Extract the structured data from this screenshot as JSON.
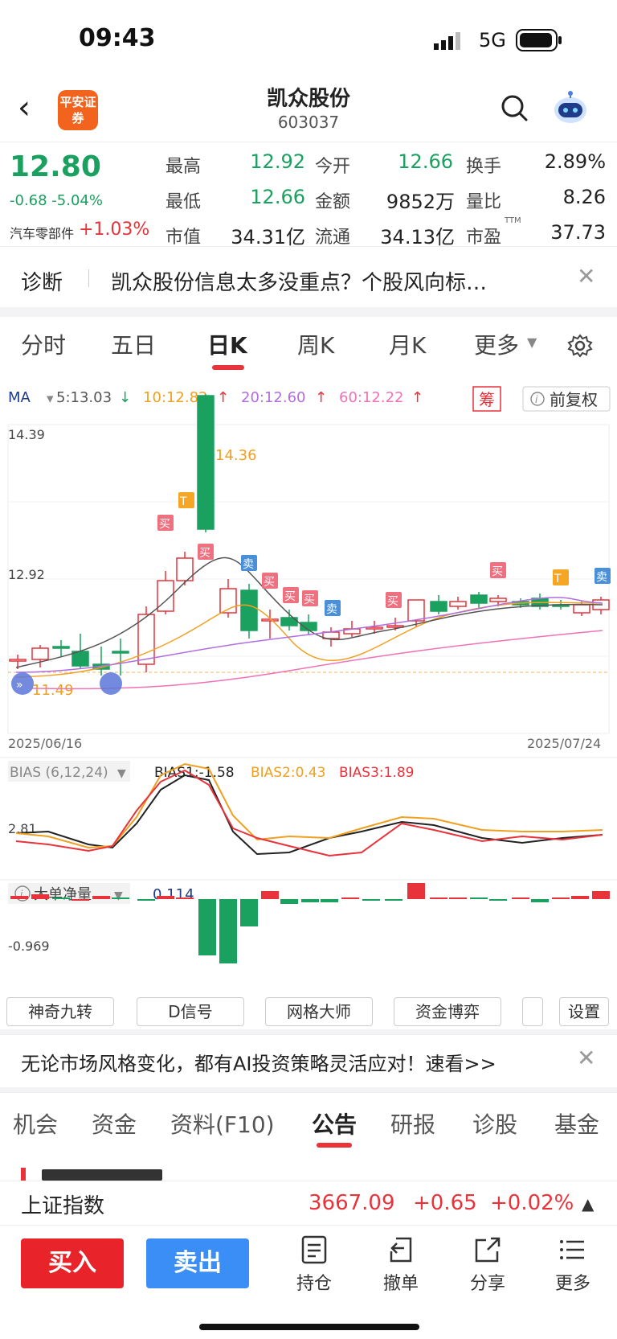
{
  "status_bar": {
    "time": "09:43",
    "network": "5G"
  },
  "header": {
    "logo_text": "平安证券",
    "stock_name": "凯众股份",
    "stock_code": "603037"
  },
  "quote": {
    "price": "12.80",
    "change": "-0.68 -5.04%",
    "sector": "汽车零部件",
    "sector_change": "+1.03%",
    "rows": [
      [
        {
          "label": "最高",
          "value": "12.92",
          "color": "#1aa15f"
        },
        {
          "label": "今开",
          "value": "12.66",
          "color": "#1aa15f"
        },
        {
          "label": "换手",
          "value": "2.89%",
          "color": "#222222"
        }
      ],
      [
        {
          "label": "最低",
          "value": "12.66",
          "color": "#1aa15f"
        },
        {
          "label": "金额",
          "value": "9852万",
          "color": "#222222"
        },
        {
          "label": "量比",
          "value": "8.26",
          "color": "#222222"
        }
      ],
      [
        {
          "label": "市值",
          "value": "34.31亿",
          "color": "#222222"
        },
        {
          "label": "流通",
          "value": "34.13亿",
          "color": "#222222"
        },
        {
          "label": "市盈",
          "value": "37.73",
          "color": "#222222"
        }
      ]
    ],
    "pe_suffix": "TTM"
  },
  "diagnosis": {
    "label": "诊断",
    "text": "凯众股份信息太多没重点？个股风向标…"
  },
  "period_tabs": [
    "分时",
    "五日",
    "日K",
    "周K",
    "月K",
    "更多"
  ],
  "ma_legend": {
    "label": "MA",
    "items": [
      {
        "text": "5:13.03",
        "arrow": "↓",
        "color": "#555555",
        "arrow_color": "#1aa15f"
      },
      {
        "text": "10:12.82",
        "arrow": "↑",
        "color": "#f0a020",
        "arrow_color": "#e8333a"
      },
      {
        "text": "20:12.60",
        "arrow": "↑",
        "color": "#b06ee0",
        "arrow_color": "#e8333a"
      },
      {
        "text": "60:12.22",
        "arrow": "↑",
        "color": "#f072b6",
        "arrow_color": "#e8333a"
      }
    ],
    "chip_label": "筹",
    "adjust_label": "前复权"
  },
  "kline": {
    "y_top_label": "14.39",
    "y_mid_label": "12.92",
    "y_low_label": "11.49",
    "high_label": "14.36",
    "date_start": "2025/06/16",
    "date_end": "2025/07/24",
    "signals": {
      "buy": "买",
      "sell": "卖",
      "t": "T"
    }
  },
  "bias": {
    "label": "BIAS (6,12,24)",
    "b1": "BIAS1:-1.58",
    "b2": "BIAS2:0.43",
    "b3": "BIAS3:1.89",
    "y_label": "2.81"
  },
  "bigorder": {
    "label": "大单净量",
    "value": "0.114",
    "y_label": "-0.969"
  },
  "tools": [
    "神奇九转",
    "D信号",
    "网格大师",
    "资金博弈",
    "设置"
  ],
  "ad": {
    "text": "无论市场风格变化，都有AI投资策略灵活应对！速看>>"
  },
  "info_tabs": [
    "机会",
    "资金",
    "资料(F10)",
    "公告",
    "研报",
    "诊股",
    "基金"
  ],
  "index_bar": {
    "name": "上证指数",
    "value": "3667.09",
    "change": "+0.65",
    "pct": "+0.02%"
  },
  "actions": {
    "buy": "买入",
    "sell": "卖出",
    "items": [
      "持仓",
      "撤单",
      "分享",
      "更多"
    ]
  },
  "colors": {
    "up": "#e8333a",
    "down": "#1aa15f",
    "accent": "#e8333a",
    "sell_button": "#3a8ef5"
  }
}
